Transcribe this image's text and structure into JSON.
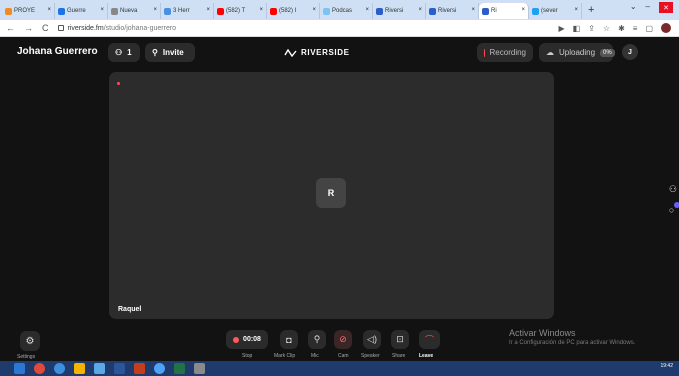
{
  "browser": {
    "tabs": [
      {
        "title": "PROYE",
        "color": "#f08a24"
      },
      {
        "title": "Guerre",
        "color": "#1a73e8"
      },
      {
        "title": "Nueva",
        "color": "#888888"
      },
      {
        "title": "3 Herr",
        "color": "#4a90e2"
      },
      {
        "title": "(582) T",
        "color": "#ff0000"
      },
      {
        "title": "(582) I",
        "color": "#ff0000"
      },
      {
        "title": "Podcas",
        "color": "#7cc3f2"
      },
      {
        "title": "Riversi",
        "color": "#2b5dcc"
      },
      {
        "title": "Riversi",
        "color": "#2b5dcc"
      },
      {
        "title": "Ri",
        "color": "#2b5dcc",
        "active": true
      },
      {
        "title": "(sever",
        "color": "#1da1f2"
      }
    ],
    "new_tab": "+",
    "url_host": "riverside.fm",
    "url_path": "/studio/johana-guerrero"
  },
  "header": {
    "host_name": "Johana Guerrero",
    "people_count": "1",
    "invite_label": "Invite",
    "logo_text": "RIVERSIDE",
    "recording_label": "Recording",
    "uploading_label": "Uploading",
    "upload_percent": "0%",
    "avatar_initial": "J"
  },
  "stage": {
    "participant_initial": "R",
    "participant_name": "Raquel"
  },
  "controls": {
    "settings_label": "Settings",
    "timer": "00:08",
    "labels": {
      "stop": "Stop",
      "mark_clip": "Mark Clip",
      "mic": "Mic",
      "cam": "Cam",
      "speaker": "Speaker",
      "share": "Share",
      "leave": "Leave"
    }
  },
  "watermark": {
    "title": "Activar Windows",
    "subtitle": "Ir a Configuración de PC para activar Windows."
  },
  "taskbar": {
    "time": "19:42"
  },
  "colors": {
    "background": "#121212",
    "stage": "#2c2c2c",
    "record_red": "#ff4d4d"
  }
}
